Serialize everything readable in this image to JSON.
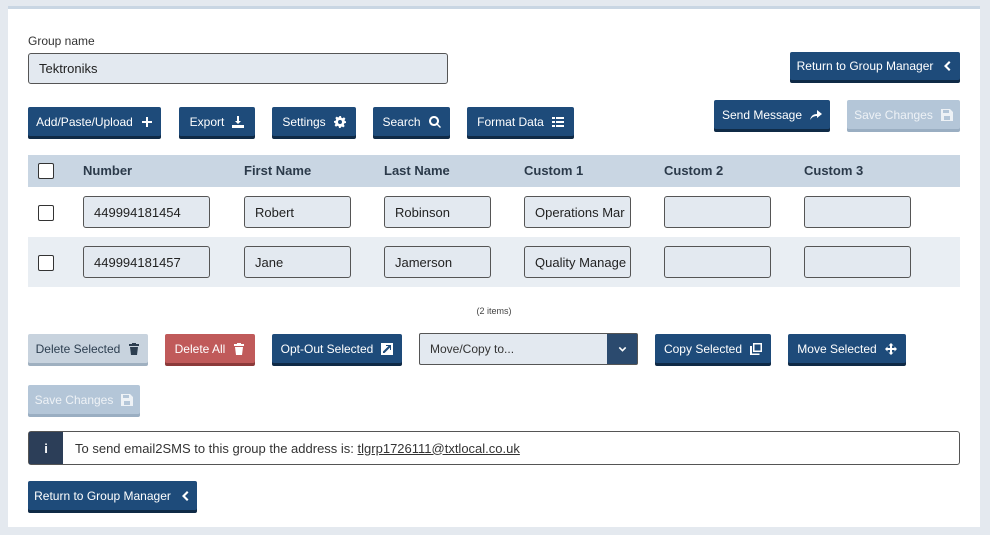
{
  "group": {
    "label": "Group name",
    "value": "Tektroniks"
  },
  "top_buttons": {
    "return_label": "Return to Group Manager",
    "send_message": "Send Message",
    "save_changes": "Save Changes"
  },
  "toolbar": {
    "add": "Add/Paste/Upload",
    "export": "Export",
    "settings": "Settings",
    "search": "Search",
    "format": "Format Data"
  },
  "table": {
    "headers": [
      "Number",
      "First Name",
      "Last Name",
      "Custom 1",
      "Custom 2",
      "Custom 3"
    ],
    "rows": [
      {
        "number": "449994181454",
        "first": "Robert",
        "last": "Robinson",
        "custom1": "Operations Mar",
        "custom2": "",
        "custom3": ""
      },
      {
        "number": "449994181457",
        "first": "Jane",
        "last": "Jamerson",
        "custom1": "Quality Manage",
        "custom2": "",
        "custom3": ""
      }
    ],
    "count_text": "(2 items)"
  },
  "actions": {
    "delete_selected": "Delete Selected",
    "delete_all": "Delete All",
    "opt_out": "Opt-Out Selected",
    "move_copy_placeholder": "Move/Copy to...",
    "copy_selected": "Copy Selected",
    "move_selected": "Move Selected",
    "save_changes": "Save Changes"
  },
  "info": {
    "icon": "i",
    "text": "To send email2SMS to this group the address is: ",
    "email": "tlgrp1726111@txtlocal.co.uk"
  },
  "bottom": {
    "return_label": "Return to Group Manager"
  },
  "colors": {
    "primary": "#1e4b7a",
    "danger": "#c05a5a",
    "disabled": "#b4c6d8",
    "table_header": "#c9d6e3",
    "row_alt": "#e9eef3"
  }
}
